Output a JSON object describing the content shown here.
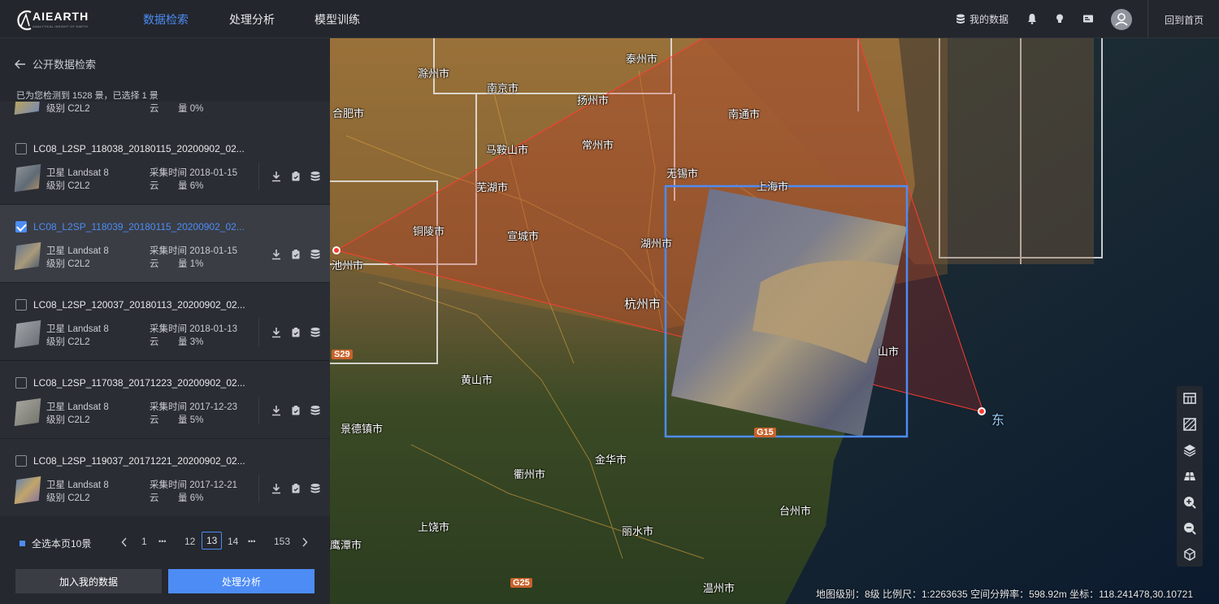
{
  "app": {
    "logo_word": "AIEARTH",
    "logo_sub": "ANALYTICAL INSIGHT OF EARTH"
  },
  "nav": {
    "tab1": "数据检索",
    "tab2": "处理分析",
    "tab3": "模型训练"
  },
  "header": {
    "my_data": "我的数据",
    "home": "回到首页"
  },
  "panel": {
    "back": "公开数据检索",
    "found": "已为您检测到 1528 景，已选择 1 景",
    "partial": {
      "level": "级别 C2L2",
      "cloud_label": "云",
      "cloud_value": "量 0%"
    },
    "items": [
      {
        "title": "LC08_L2SP_118038_20180115_20200902_02...",
        "sat": "卫星 Landsat 8",
        "level": "级别 C2L2",
        "time": "采集时间 2018-01-15",
        "cloud_label": "云",
        "cloud": "量 6%",
        "checked": false
      },
      {
        "title": "LC08_L2SP_118039_20180115_20200902_02...",
        "sat": "卫星 Landsat 8",
        "level": "级别 C2L2",
        "time": "采集时间 2018-01-15",
        "cloud_label": "云",
        "cloud": "量 1%",
        "checked": true
      },
      {
        "title": "LC08_L2SP_120037_20180113_20200902_02...",
        "sat": "卫星 Landsat 8",
        "level": "级别 C2L2",
        "time": "采集时间 2018-01-13",
        "cloud_label": "云",
        "cloud": "量 3%",
        "checked": false
      },
      {
        "title": "LC08_L2SP_117038_20171223_20200902_02...",
        "sat": "卫星 Landsat 8",
        "level": "级别 C2L2",
        "time": "采集时间 2017-12-23",
        "cloud_label": "云",
        "cloud": "量 5%",
        "checked": false
      },
      {
        "title": "LC08_L2SP_119037_20171221_20200902_02...",
        "sat": "卫星 Landsat 8",
        "level": "级别 C2L2",
        "time": "采集时间 2017-12-21",
        "cloud_label": "云",
        "cloud": "量 6%",
        "checked": false
      }
    ],
    "pager": {
      "select_all": "全选本页10景",
      "p1": "1",
      "dots1": "•••",
      "p12": "12",
      "p13": "13",
      "p14": "14",
      "dots2": "•••",
      "plast": "153"
    },
    "btn_add": "加入我的数据",
    "btn_process": "处理分析"
  },
  "map": {
    "labels": {
      "chuzhou": "滁州市",
      "nanjing": "南京市",
      "taizhou": "泰州市",
      "yangzhou": "扬州市",
      "hefei": "合肥市",
      "maanshan": "马鞍山市",
      "changzhou": "常州市",
      "nantong": "南通市",
      "wuxi": "无锡市",
      "shanghai": "上海市",
      "wuhu": "芜湖市",
      "tongling": "铜陵市",
      "xuancheng": "宣城市",
      "huzhou": "湖州市",
      "chizhou": "池州市",
      "hangzhou": "杭州市",
      "huangshan": "黄山市",
      "jingdezhen": "景德镇市",
      "jinhua": "金华市",
      "quzhou": "衢州市",
      "shangrao": "上饶市",
      "lishui": "丽水市",
      "taizhou2": "台州市",
      "yingtan": "鹰潭市",
      "wenzhou": "温州市",
      "ningbo": "山市",
      "dong": "东"
    },
    "roads": {
      "s29": "S29",
      "g15": "G15",
      "g25": "G25"
    },
    "status": "地图级别：8级   比例尺：1:2263635   空间分辨率：598.92m   坐标：118.241478,30.10721"
  }
}
